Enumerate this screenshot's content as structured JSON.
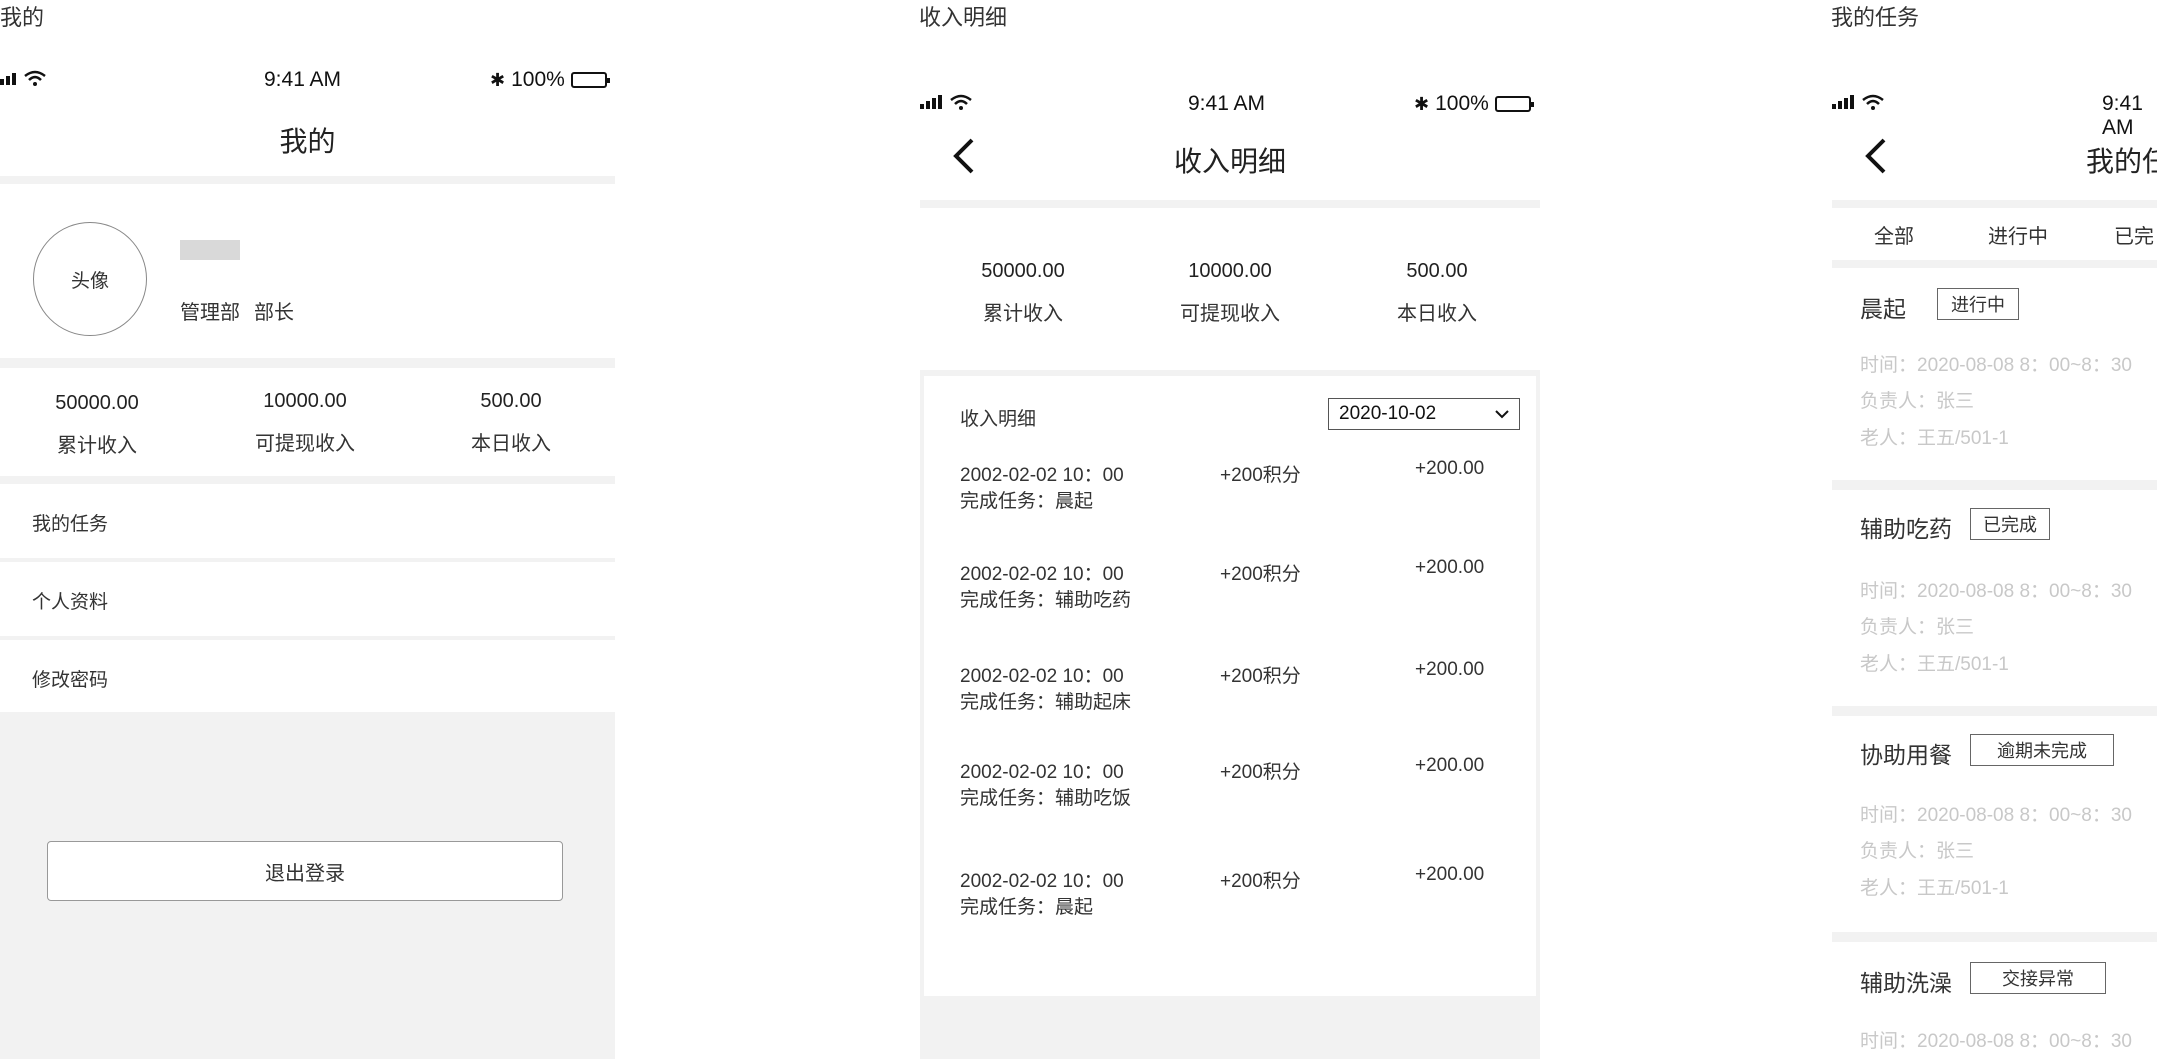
{
  "labels": {
    "page1": "我的",
    "page2": "收入明细",
    "page3": "我的任务"
  },
  "status": {
    "time": "9:41 AM",
    "battery": "100%",
    "battery_level": 1.0
  },
  "mine": {
    "title": "我的",
    "avatar": "头像",
    "dept": "管理部",
    "role": "部长",
    "stats": [
      {
        "value": "50000.00",
        "label": "累计收入"
      },
      {
        "value": "10000.00",
        "label": "可提现收入"
      },
      {
        "value": "500.00",
        "label": "本日收入"
      }
    ],
    "menu": [
      "我的任务",
      "个人资料",
      "修改密码"
    ],
    "logout": "退出登录"
  },
  "income": {
    "title": "收入明细",
    "stats": [
      {
        "value": "50000.00",
        "label": "累计收入"
      },
      {
        "value": "10000.00",
        "label": "可提现收入"
      },
      {
        "value": "500.00",
        "label": "本日收入"
      }
    ],
    "list_title": "收入明细",
    "date": "2020-10-02",
    "records": [
      {
        "time": "2002-02-02 10：00",
        "desc": "完成任务：晨起",
        "points": "+200积分",
        "amount": "+200.00"
      },
      {
        "time": "2002-02-02 10：00",
        "desc": "完成任务：辅助吃药",
        "points": "+200积分",
        "amount": "+200.00"
      },
      {
        "time": "2002-02-02 10：00",
        "desc": "完成任务：辅助起床",
        "points": "+200积分",
        "amount": "+200.00"
      },
      {
        "time": "2002-02-02 10：00",
        "desc": "完成任务：辅助吃饭",
        "points": "+200积分",
        "amount": "+200.00"
      },
      {
        "time": "2002-02-02 10：00",
        "desc": "完成任务：晨起",
        "points": "+200积分",
        "amount": "+200.00"
      }
    ]
  },
  "tasks": {
    "title": "我的任",
    "tabs": [
      "全部",
      "进行中",
      "已完"
    ],
    "items": [
      {
        "name": "晨起",
        "status": "进行中",
        "time": "时间：2020-08-08  8：00~8：30",
        "owner": "负责人：张三",
        "elder": "老人：王五/501-1"
      },
      {
        "name": "辅助吃药",
        "status": "已完成",
        "time": "时间：2020-08-08  8：00~8：30",
        "owner": "负责人：张三",
        "elder": "老人：王五/501-1"
      },
      {
        "name": "协助用餐",
        "status": "逾期未完成",
        "time": "时间：2020-08-08  8：00~8：30",
        "owner": "负责人：张三",
        "elder": "老人：王五/501-1"
      },
      {
        "name": "辅助洗澡",
        "status": "交接异常",
        "time": "时间：2020-08-08  8：00~8：30"
      }
    ]
  }
}
